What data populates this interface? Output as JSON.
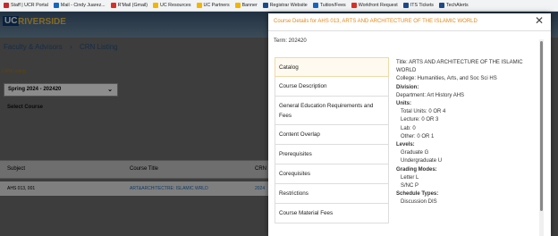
{
  "bookmarks": [
    {
      "label": "Staff | UCR Portal",
      "color": "#c9272d"
    },
    {
      "label": "Mail - Cindy Juarez...",
      "color": "#1565c0"
    },
    {
      "label": "R'Mail (Gmail)",
      "color": "#d93025"
    },
    {
      "label": "UC Resources",
      "color": "#f4b400"
    },
    {
      "label": "UC Partners",
      "color": "#f4b400"
    },
    {
      "label": "Banner",
      "color": "#f4b400"
    },
    {
      "label": "Registrar Website",
      "color": "#1a4a8a"
    },
    {
      "label": "Tuition/Fees",
      "color": "#1565c0"
    },
    {
      "label": "Workfront Request",
      "color": "#d93025"
    },
    {
      "label": "ITS Tickets",
      "color": "#1a4a8a"
    },
    {
      "label": "TechAlerts",
      "color": "#1a4a8a"
    }
  ],
  "banner": {
    "logo_uc": "UC",
    "logo_riverside": "RIVERSIDE"
  },
  "breadcrumb": {
    "item1": "Faculty & Advisors",
    "sep": "›",
    "item2": "CRN Listing"
  },
  "crn_label": "CRN Listing",
  "term_select": {
    "value": "Spring 2024 - 202420",
    "chev": "⌄"
  },
  "select_course": "Select Course",
  "table": {
    "headers": [
      "Subject",
      "Course Title",
      "CRN"
    ],
    "rows": [
      [
        "AHS 013, 001",
        "ART&ARCHITECTRE: ISLAMIC WRLD",
        "2024"
      ]
    ]
  },
  "modal": {
    "title": "Course Details for AHS 013, ARTS AND ARCHITECTURE OF THE ISLAMIC WORLD",
    "close": "✕",
    "term": "Term: 202420",
    "nav": [
      "Catalog",
      "Course Description",
      "General Education Requirements and Fees",
      "Content Overlap",
      "Prerequisites",
      "Corequisites",
      "Restrictions",
      "Course Material Fees"
    ],
    "details": {
      "title": "Title: ARTS AND ARCHITECTURE OF THE ISLAMIC WORLD",
      "college": "College: Humanities, Arts, and Soc Sci HS",
      "division": "Division:",
      "department": "Department: Art History AHS",
      "units_label": "Units:",
      "units": [
        "Total Units: 0 OR 4",
        "Lecture: 0 OR 3",
        "Lab: 0",
        "Other: 0 OR 1"
      ],
      "levels_label": "Levels:",
      "levels": [
        "Graduate G",
        "Undergraduate U"
      ],
      "grading_label": "Grading Modes:",
      "grading": [
        "Letter L",
        "S/NC P"
      ],
      "schedule_label": "Schedule Types:",
      "schedule": [
        "Discussion DIS"
      ]
    }
  }
}
